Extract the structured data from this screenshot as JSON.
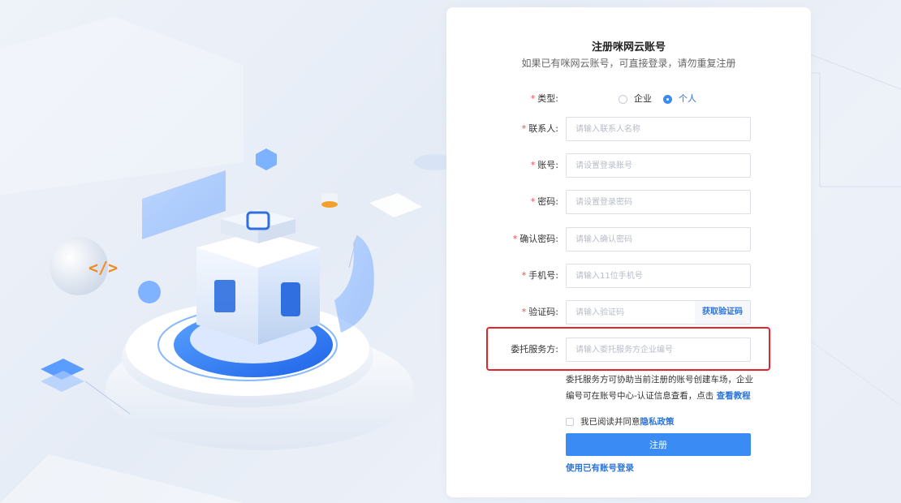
{
  "form": {
    "title": "注册咪网云账号",
    "subtitle": "如果已有咪网云账号，可直接登录，请勿重复注册",
    "required_mark": "*",
    "type": {
      "label": "类型:",
      "options": [
        "企业",
        "个人"
      ],
      "selected": "个人"
    },
    "contact": {
      "label": "联系人:",
      "placeholder": "请输入联系人名称"
    },
    "account": {
      "label": "账号:",
      "placeholder": "请设置登录账号"
    },
    "password": {
      "label": "密码:",
      "placeholder": "请设置登录密码"
    },
    "confirm": {
      "label": "确认密码:",
      "placeholder": "请输入确认密码"
    },
    "phone": {
      "label": "手机号:",
      "placeholder": "请输入11位手机号"
    },
    "code": {
      "label": "验证码:",
      "placeholder": "请输入验证码",
      "button": "获取验证码"
    },
    "service": {
      "label": "委托服务方:",
      "placeholder": "请输入委托服务方企业编号"
    },
    "hint": {
      "text": "委托服务方可协助当前注册的账号创建车场，企业编号可在账号中心-认证信息查看，点击 ",
      "link": "查看教程"
    },
    "agreement": {
      "text": "我已阅读并同意 ",
      "link": "隐私政策"
    },
    "submit_label": "注册",
    "login_link": "使用已有账号登录"
  },
  "colors": {
    "primary": "#3b8bf5",
    "link": "#2c74d8",
    "required": "#f04b4b",
    "highlight": "#e2242b"
  }
}
